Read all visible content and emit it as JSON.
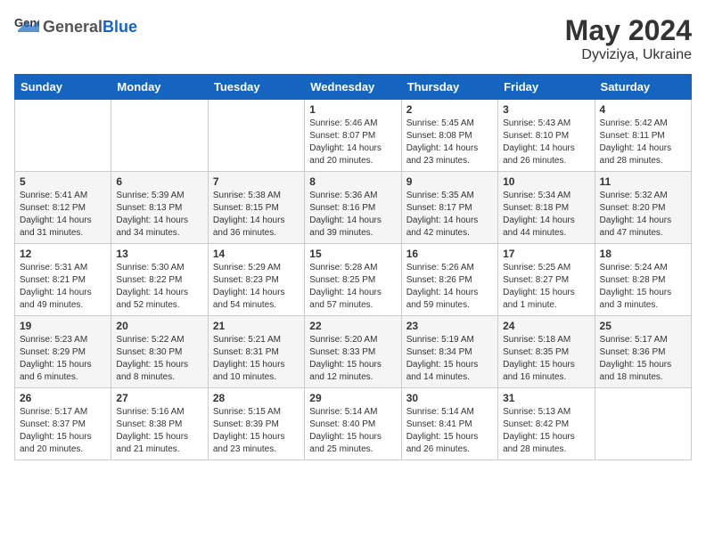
{
  "header": {
    "logo_general": "General",
    "logo_blue": "Blue",
    "month": "May 2024",
    "location": "Dyviziya, Ukraine"
  },
  "weekdays": [
    "Sunday",
    "Monday",
    "Tuesday",
    "Wednesday",
    "Thursday",
    "Friday",
    "Saturday"
  ],
  "weeks": [
    [
      {
        "day": "",
        "info": ""
      },
      {
        "day": "",
        "info": ""
      },
      {
        "day": "",
        "info": ""
      },
      {
        "day": "1",
        "info": "Sunrise: 5:46 AM\nSunset: 8:07 PM\nDaylight: 14 hours\nand 20 minutes."
      },
      {
        "day": "2",
        "info": "Sunrise: 5:45 AM\nSunset: 8:08 PM\nDaylight: 14 hours\nand 23 minutes."
      },
      {
        "day": "3",
        "info": "Sunrise: 5:43 AM\nSunset: 8:10 PM\nDaylight: 14 hours\nand 26 minutes."
      },
      {
        "day": "4",
        "info": "Sunrise: 5:42 AM\nSunset: 8:11 PM\nDaylight: 14 hours\nand 28 minutes."
      }
    ],
    [
      {
        "day": "5",
        "info": "Sunrise: 5:41 AM\nSunset: 8:12 PM\nDaylight: 14 hours\nand 31 minutes."
      },
      {
        "day": "6",
        "info": "Sunrise: 5:39 AM\nSunset: 8:13 PM\nDaylight: 14 hours\nand 34 minutes."
      },
      {
        "day": "7",
        "info": "Sunrise: 5:38 AM\nSunset: 8:15 PM\nDaylight: 14 hours\nand 36 minutes."
      },
      {
        "day": "8",
        "info": "Sunrise: 5:36 AM\nSunset: 8:16 PM\nDaylight: 14 hours\nand 39 minutes."
      },
      {
        "day": "9",
        "info": "Sunrise: 5:35 AM\nSunset: 8:17 PM\nDaylight: 14 hours\nand 42 minutes."
      },
      {
        "day": "10",
        "info": "Sunrise: 5:34 AM\nSunset: 8:18 PM\nDaylight: 14 hours\nand 44 minutes."
      },
      {
        "day": "11",
        "info": "Sunrise: 5:32 AM\nSunset: 8:20 PM\nDaylight: 14 hours\nand 47 minutes."
      }
    ],
    [
      {
        "day": "12",
        "info": "Sunrise: 5:31 AM\nSunset: 8:21 PM\nDaylight: 14 hours\nand 49 minutes."
      },
      {
        "day": "13",
        "info": "Sunrise: 5:30 AM\nSunset: 8:22 PM\nDaylight: 14 hours\nand 52 minutes."
      },
      {
        "day": "14",
        "info": "Sunrise: 5:29 AM\nSunset: 8:23 PM\nDaylight: 14 hours\nand 54 minutes."
      },
      {
        "day": "15",
        "info": "Sunrise: 5:28 AM\nSunset: 8:25 PM\nDaylight: 14 hours\nand 57 minutes."
      },
      {
        "day": "16",
        "info": "Sunrise: 5:26 AM\nSunset: 8:26 PM\nDaylight: 14 hours\nand 59 minutes."
      },
      {
        "day": "17",
        "info": "Sunrise: 5:25 AM\nSunset: 8:27 PM\nDaylight: 15 hours\nand 1 minute."
      },
      {
        "day": "18",
        "info": "Sunrise: 5:24 AM\nSunset: 8:28 PM\nDaylight: 15 hours\nand 3 minutes."
      }
    ],
    [
      {
        "day": "19",
        "info": "Sunrise: 5:23 AM\nSunset: 8:29 PM\nDaylight: 15 hours\nand 6 minutes."
      },
      {
        "day": "20",
        "info": "Sunrise: 5:22 AM\nSunset: 8:30 PM\nDaylight: 15 hours\nand 8 minutes."
      },
      {
        "day": "21",
        "info": "Sunrise: 5:21 AM\nSunset: 8:31 PM\nDaylight: 15 hours\nand 10 minutes."
      },
      {
        "day": "22",
        "info": "Sunrise: 5:20 AM\nSunset: 8:33 PM\nDaylight: 15 hours\nand 12 minutes."
      },
      {
        "day": "23",
        "info": "Sunrise: 5:19 AM\nSunset: 8:34 PM\nDaylight: 15 hours\nand 14 minutes."
      },
      {
        "day": "24",
        "info": "Sunrise: 5:18 AM\nSunset: 8:35 PM\nDaylight: 15 hours\nand 16 minutes."
      },
      {
        "day": "25",
        "info": "Sunrise: 5:17 AM\nSunset: 8:36 PM\nDaylight: 15 hours\nand 18 minutes."
      }
    ],
    [
      {
        "day": "26",
        "info": "Sunrise: 5:17 AM\nSunset: 8:37 PM\nDaylight: 15 hours\nand 20 minutes."
      },
      {
        "day": "27",
        "info": "Sunrise: 5:16 AM\nSunset: 8:38 PM\nDaylight: 15 hours\nand 21 minutes."
      },
      {
        "day": "28",
        "info": "Sunrise: 5:15 AM\nSunset: 8:39 PM\nDaylight: 15 hours\nand 23 minutes."
      },
      {
        "day": "29",
        "info": "Sunrise: 5:14 AM\nSunset: 8:40 PM\nDaylight: 15 hours\nand 25 minutes."
      },
      {
        "day": "30",
        "info": "Sunrise: 5:14 AM\nSunset: 8:41 PM\nDaylight: 15 hours\nand 26 minutes."
      },
      {
        "day": "31",
        "info": "Sunrise: 5:13 AM\nSunset: 8:42 PM\nDaylight: 15 hours\nand 28 minutes."
      },
      {
        "day": "",
        "info": ""
      }
    ]
  ]
}
